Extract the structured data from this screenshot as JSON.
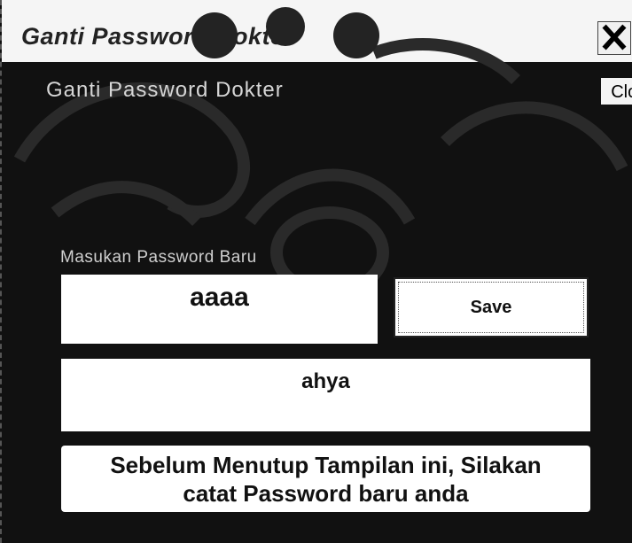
{
  "window": {
    "title": "Ganti Password Dokter",
    "close_glyph": "✕",
    "close_icon": "close-icon"
  },
  "form": {
    "heading": "Ganti Password Dokter",
    "close_button_label": "Clo:",
    "new_password_label": "Masukan Password Baru",
    "new_password_value": "aaaa",
    "save_button_label": "Save",
    "display_value": "ahya",
    "notice_line1": "Sebelum Menutup Tampilan ini, Silakan",
    "notice_line2": "catat Password baru anda"
  },
  "colors": {
    "background": "#111111",
    "titlebar": "#f5f5f5",
    "field": "#ffffff"
  }
}
